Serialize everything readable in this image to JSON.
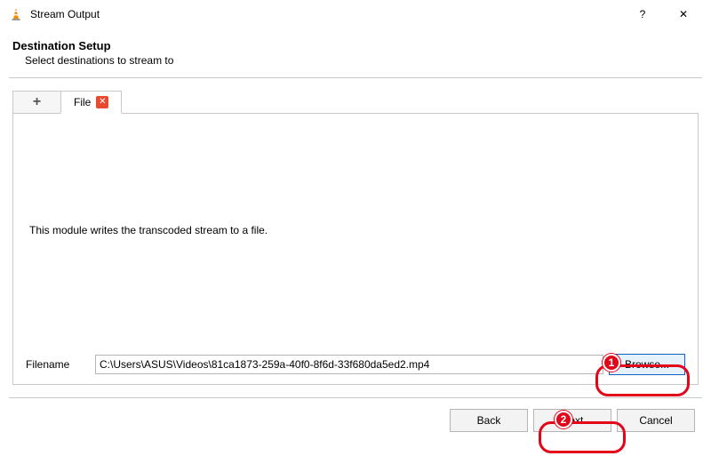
{
  "window": {
    "title": "Stream Output",
    "help_symbol": "?",
    "close_symbol": "✕"
  },
  "header": {
    "title": "Destination Setup",
    "subtitle": "Select destinations to stream to"
  },
  "tabs": {
    "add_symbol": "+",
    "file_tab_label": "File",
    "file_close_symbol": "✕"
  },
  "body": {
    "description": "This module writes the transcoded stream to a file."
  },
  "file": {
    "label": "Filename",
    "value": "C:\\Users\\ASUS\\Videos\\81ca1873-259a-40f0-8f6d-33f680da5ed2.mp4",
    "browse_label": "Browse..."
  },
  "footer": {
    "back": "Back",
    "next": "Next",
    "cancel": "Cancel"
  },
  "annotations": {
    "badge1": "1",
    "badge2": "2"
  }
}
